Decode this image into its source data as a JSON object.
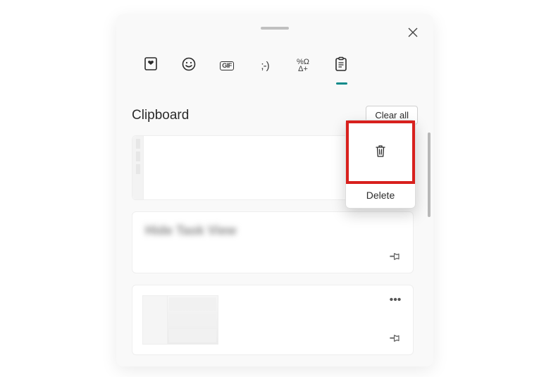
{
  "header": {
    "tabs": [
      {
        "name": "recent-tab",
        "icon": "heart-note-icon",
        "active": false
      },
      {
        "name": "emoji-tab",
        "icon": "smiley-icon",
        "active": false
      },
      {
        "name": "gif-tab",
        "icon": "gif-icon",
        "label": "GIF",
        "active": false
      },
      {
        "name": "kaomoji-tab",
        "icon": "kaomoji-icon",
        "label": ";-)",
        "active": false
      },
      {
        "name": "symbols-tab",
        "icon": "symbols-icon",
        "label_top": "%Ω",
        "label_bot": "Δ+",
        "active": false
      },
      {
        "name": "clipboard-tab",
        "icon": "clipboard-icon",
        "active": true
      }
    ]
  },
  "section": {
    "title": "Clipboard",
    "clear_all_label": "Clear all"
  },
  "items": [
    {
      "has_more": true,
      "has_pin": true
    },
    {
      "blurred_text": "Hide Task View",
      "has_pin": true
    },
    {
      "has_more": true,
      "has_pin": true
    }
  ],
  "popup": {
    "delete_label": "Delete"
  },
  "highlight_color": "#d8201d"
}
